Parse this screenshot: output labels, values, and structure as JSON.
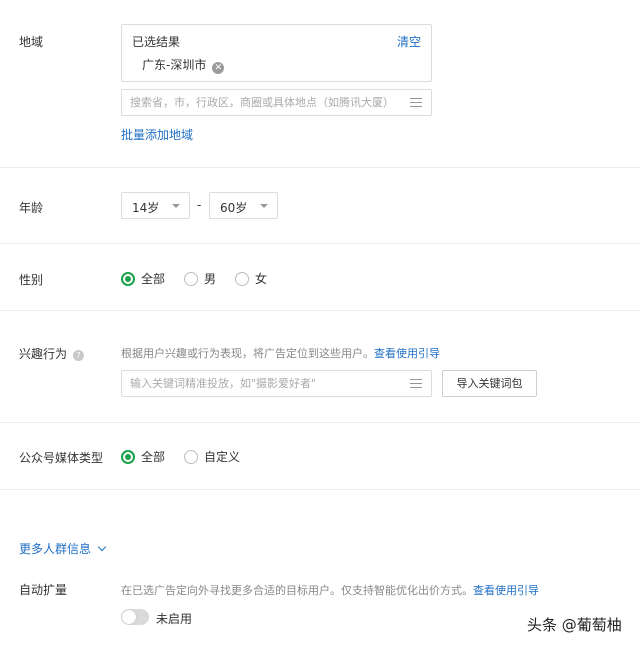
{
  "region": {
    "label": "地域",
    "selected_title": "已选结果",
    "clear_label": "清空",
    "selected_tag": "广东-深圳市",
    "search_placeholder": "搜索省，市，行政区，商圈或具体地点（如腾讯大厦）",
    "batch_add_label": "批量添加地域"
  },
  "age": {
    "label": "年龄",
    "min_value": "14岁",
    "separator": "-",
    "max_value": "60岁"
  },
  "gender": {
    "label": "性别",
    "options": [
      "全部",
      "男",
      "女"
    ],
    "selected": "全部"
  },
  "interest": {
    "label": "兴趣行为",
    "description": "根据用户兴趣或行为表现，将广告定位到这些用户。",
    "guide_link": "查看使用引导",
    "keyword_placeholder": "输入关键词精准投放，如\"摄影爱好者\"",
    "import_button": "导入关键词包"
  },
  "media_type": {
    "label": "公众号媒体类型",
    "options": [
      "全部",
      "自定义"
    ],
    "selected": "全部"
  },
  "more": {
    "label": "更多人群信息"
  },
  "auto_expand": {
    "label": "自动扩量",
    "description": "在已选广告定向外寻找更多合适的目标用户。仅支持智能优化出价方式。",
    "guide_link": "查看使用引导",
    "toggle_state": "未启用"
  },
  "watermark": "头条 @葡萄柚",
  "colors": {
    "accent_green": "#19a24a",
    "link_blue": "#1f6fc5"
  }
}
